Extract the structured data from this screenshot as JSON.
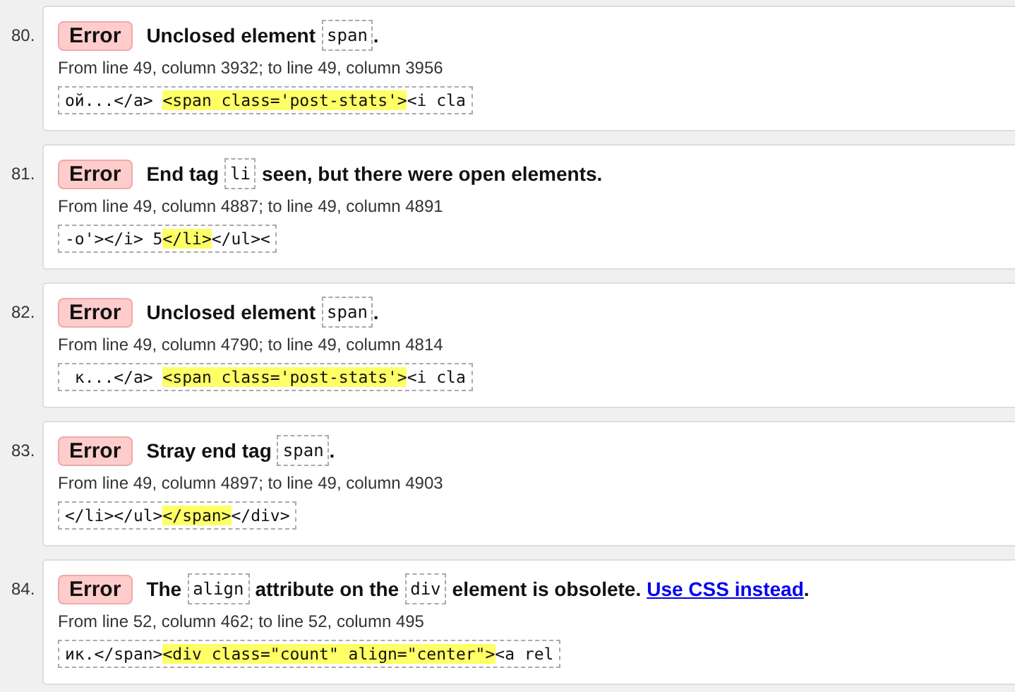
{
  "messages": [
    {
      "number": "80.",
      "type": "Error",
      "message": [
        {
          "kind": "text",
          "text": "Unclosed element"
        },
        {
          "kind": "code",
          "text": "span"
        },
        {
          "kind": "text",
          "text": "."
        }
      ],
      "location": "From line 49, column 3932; to line 49, column 3956",
      "extract": {
        "before": "ой...</a> ",
        "highlight": "<span class='post-stats'>",
        "after": "<i cla"
      }
    },
    {
      "number": "81.",
      "type": "Error",
      "message": [
        {
          "kind": "text",
          "text": "End tag"
        },
        {
          "kind": "code",
          "text": "li"
        },
        {
          "kind": "text",
          "text": "seen, but there were open elements."
        }
      ],
      "location": "From line 49, column 4887; to line 49, column 4891",
      "extract": {
        "before": "-o'></i> 5",
        "highlight": "</li>",
        "after": "</ul><"
      }
    },
    {
      "number": "82.",
      "type": "Error",
      "message": [
        {
          "kind": "text",
          "text": "Unclosed element"
        },
        {
          "kind": "code",
          "text": "span"
        },
        {
          "kind": "text",
          "text": "."
        }
      ],
      "location": "From line 49, column 4790; to line 49, column 4814",
      "extract": {
        "before": " к...</a> ",
        "highlight": "<span class='post-stats'>",
        "after": "<i cla"
      }
    },
    {
      "number": "83.",
      "type": "Error",
      "message": [
        {
          "kind": "text",
          "text": "Stray end tag"
        },
        {
          "kind": "code",
          "text": "span"
        },
        {
          "kind": "text",
          "text": "."
        }
      ],
      "location": "From line 49, column 4897; to line 49, column 4903",
      "extract": {
        "before": "</li></ul>",
        "highlight": "</span>",
        "after": "</div>"
      }
    },
    {
      "number": "84.",
      "type": "Error",
      "message": [
        {
          "kind": "text",
          "text": "The"
        },
        {
          "kind": "code",
          "text": "align"
        },
        {
          "kind": "text",
          "text": "attribute on the"
        },
        {
          "kind": "code",
          "text": "div"
        },
        {
          "kind": "text",
          "text": "element is obsolete."
        },
        {
          "kind": "link",
          "text": "Use CSS instead"
        },
        {
          "kind": "text",
          "text": "."
        }
      ],
      "location": "From line 52, column 462; to line 52, column 495",
      "extract": {
        "before": "ик.</span>",
        "highlight": "<div class=\"count\" align=\"center\">",
        "after": "<a rel"
      }
    }
  ]
}
